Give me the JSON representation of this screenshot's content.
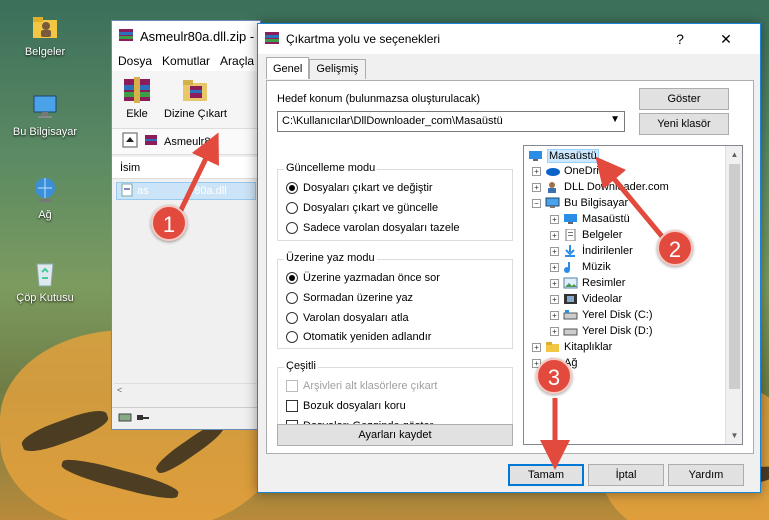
{
  "desktop": {
    "icons": [
      {
        "label": "Belgeler",
        "icon": "folder-user-icon"
      },
      {
        "label": "Bu Bilgisayar",
        "icon": "computer-icon"
      },
      {
        "label": "Ağ",
        "icon": "network-icon"
      },
      {
        "label": "Çöp Kutusu",
        "icon": "recycle-bin-icon"
      }
    ]
  },
  "winrar": {
    "title": "Asmeulr80a.dll.zip -",
    "menu": [
      "Dosya",
      "Komutlar",
      "Araçla"
    ],
    "tools": [
      "Ekle",
      "Dizine Çıkart"
    ],
    "path": "Asmeulr80",
    "column": "İsim",
    "file": "asmeulr80a.dll",
    "file_visible": "as",
    "file_tail": "r80a.dll"
  },
  "dialog": {
    "title": "Çıkartma yolu ve seçenekleri",
    "help": "?",
    "close": "✕",
    "tabs": [
      "Genel",
      "Gelişmiş"
    ],
    "dest_label": "Hedef konum (bulunmazsa oluşturulacak)",
    "dest_value": "C:\\Kullanıcılar\\DllDownloader_com\\Masaüstü",
    "show_btn": "Göster",
    "newfolder_btn": "Yeni klasör",
    "update_group": {
      "title": "Güncelleme modu",
      "options": [
        "Dosyaları çıkart ve değiştir",
        "Dosyaları çıkart ve güncelle",
        "Sadece varolan dosyaları tazele"
      ],
      "selected": 0
    },
    "overwrite_group": {
      "title": "Üzerine yaz modu",
      "options": [
        "Üzerine yazmadan önce sor",
        "Sormadan üzerine yaz",
        "Varolan dosyaları atla",
        "Otomatik yeniden adlandır"
      ],
      "selected": 0
    },
    "misc_group": {
      "title": "Çeşitli",
      "options": [
        "Arşivleri alt klasörlere çıkart",
        "Bozuk dosyaları koru",
        "Dosyaları Gezginde göster"
      ]
    },
    "save_btn": "Ayarları kaydet",
    "tree": [
      {
        "label": "Masaüstü",
        "level": 0,
        "icon": "desktop-icon",
        "selected": true
      },
      {
        "label": "OneDrive",
        "level": 1,
        "icon": "onedrive-icon"
      },
      {
        "label": "DLL Downloader.com",
        "level": 1,
        "icon": "user-icon"
      },
      {
        "label": "Bu Bilgisayar",
        "level": 1,
        "icon": "computer-icon"
      },
      {
        "label": "Masaüstü",
        "level": 2,
        "icon": "desktop-icon"
      },
      {
        "label": "Belgeler",
        "level": 2,
        "icon": "documents-icon"
      },
      {
        "label": "İndirilenler",
        "level": 2,
        "icon": "downloads-icon"
      },
      {
        "label": "Müzik",
        "level": 2,
        "icon": "music-icon"
      },
      {
        "label": "Resimler",
        "level": 2,
        "icon": "pictures-icon"
      },
      {
        "label": "Videolar",
        "level": 2,
        "icon": "videos-icon"
      },
      {
        "label": "Yerel Disk (C:)",
        "level": 2,
        "icon": "disk-icon"
      },
      {
        "label": "Yerel Disk (D:)",
        "level": 2,
        "icon": "disk-icon"
      },
      {
        "label": "Kitaplıklar",
        "level": 1,
        "icon": "libraries-icon"
      },
      {
        "label": "Ağ",
        "level": 1,
        "icon": "network-icon"
      }
    ],
    "ok_btn": "Tamam",
    "cancel_btn": "İptal",
    "help_btn": "Yardım"
  },
  "markers": [
    "1",
    "2",
    "3"
  ],
  "colors": {
    "marker": "#e24a3e",
    "accent": "#0078d7",
    "selection": "#cce8ff"
  }
}
